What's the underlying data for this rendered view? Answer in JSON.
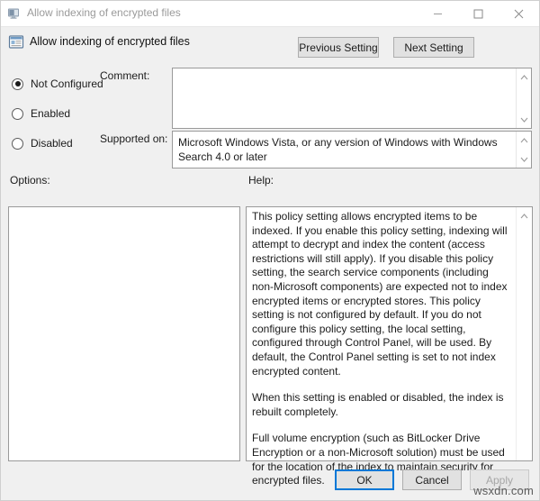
{
  "window": {
    "titlebar_title": "Allow indexing of encrypted files",
    "titlebar_icon": "computer-monitor-icon",
    "minimize_label": "Minimize",
    "maximize_label": "Maximize",
    "close_label": "Close"
  },
  "header": {
    "icon": "group-policy-setting-icon",
    "title": "Allow indexing of encrypted files",
    "previous_setting_label": "Previous Setting",
    "next_setting_label": "Next Setting"
  },
  "state_options": {
    "selected": "Not Configured",
    "items": [
      {
        "label": "Not Configured",
        "checked": true
      },
      {
        "label": "Enabled",
        "checked": false
      },
      {
        "label": "Disabled",
        "checked": false
      }
    ]
  },
  "comment": {
    "label": "Comment:",
    "value": "",
    "placeholder": ""
  },
  "supported_on": {
    "label": "Supported on:",
    "value": "Microsoft Windows Vista, or any version of Windows with Windows Search 4.0 or later"
  },
  "options": {
    "label": "Options:",
    "value": ""
  },
  "help": {
    "label": "Help:",
    "paragraphs": [
      "This policy setting allows encrypted items to be indexed. If you enable this policy setting, indexing  will attempt to decrypt and index the content (access restrictions will still apply). If you disable this policy setting, the search service components (including non-Microsoft components) are expected not to index encrypted items or encrypted stores. This policy setting is not configured by default. If you do not configure this policy setting, the local setting, configured through Control Panel, will be used. By default, the Control Panel setting is set to not index encrypted content.",
      "When this setting is enabled or disabled, the index is rebuilt completely.",
      "Full volume encryption (such as BitLocker Drive Encryption or a non-Microsoft solution) must be used for the location of the index to maintain security for encrypted files."
    ]
  },
  "footer": {
    "ok_label": "OK",
    "cancel_label": "Cancel",
    "apply_label": "Apply",
    "apply_disabled": true
  },
  "watermark": {
    "text": "wsxdn.com"
  },
  "colors": {
    "accent": "#0078d7",
    "window_bg": "#f0f0f0",
    "field_bg": "#ffffff",
    "border": "#9a9a9a",
    "disabled_text": "#a6a6a6",
    "inactive_title_text": "#9a9a9a"
  }
}
